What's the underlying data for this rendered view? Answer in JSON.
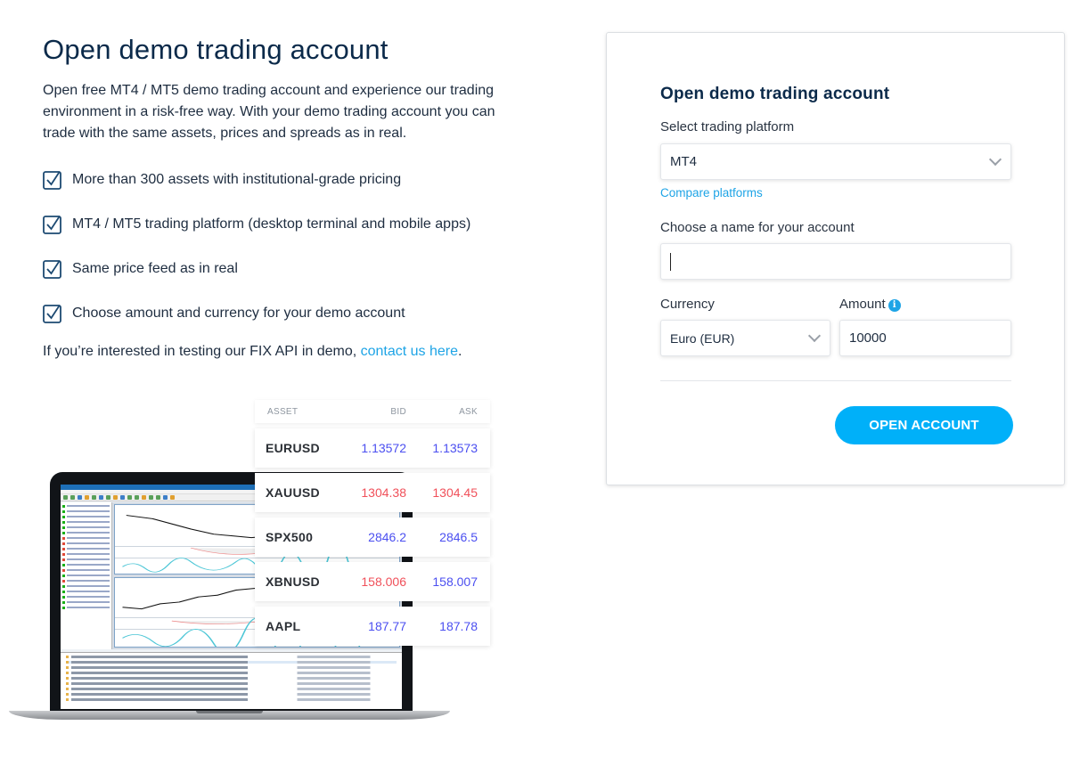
{
  "left": {
    "title": "Open demo trading account",
    "intro": "Open free MT4 / MT5 demo trading account and experience our trading environment in a risk-free way. With your demo trading account you can trade with the same assets, prices and spreads as in real.",
    "features": [
      {
        "icon": "checkbox-checked-icon",
        "text": "More than 300 assets with institutional-grade pricing"
      },
      {
        "icon": "checkbox-checked-icon",
        "text": "MT4 / MT5 trading platform (desktop terminal and mobile apps)"
      },
      {
        "icon": "checkbox-checked-icon",
        "text": "Same price feed as in real"
      },
      {
        "icon": "checkbox-checked-icon",
        "text": "Choose amount and currency for your demo account"
      }
    ],
    "fix_api": {
      "text": "If you’re interested in testing our FIX API in demo, ",
      "link_label": "contact us here",
      "suffix": "."
    }
  },
  "quotes": {
    "headers": {
      "asset": "ASSET",
      "bid": "BID",
      "ask": "ASK"
    },
    "rows": [
      {
        "asset": "EURUSD",
        "bid": "1.13572",
        "ask": "1.13573",
        "bid_dir": "up",
        "ask_dir": "up"
      },
      {
        "asset": "XAUUSD",
        "bid": "1304.38",
        "ask": "1304.45",
        "bid_dir": "down",
        "ask_dir": "down"
      },
      {
        "asset": "SPX500",
        "bid": "2846.2",
        "ask": "2846.5",
        "bid_dir": "up",
        "ask_dir": "up"
      },
      {
        "asset": "XBNUSD",
        "bid": "158.006",
        "ask": "158.007",
        "bid_dir": "down",
        "ask_dir": "up"
      },
      {
        "asset": "AAPL",
        "bid": "187.77",
        "ask": "187.78",
        "bid_dir": "up",
        "ask_dir": "up"
      }
    ],
    "colors": {
      "up": "#4b4ff0",
      "down": "#f0505a"
    }
  },
  "form": {
    "title": "Open demo trading account",
    "platform_label": "Select trading platform",
    "platform_value": "MT4",
    "compare_link": "Compare platforms",
    "name_label": "Choose a name for your account",
    "name_value": "",
    "currency_label": "Currency",
    "currency_value": "Euro (EUR)",
    "amount_label": "Amount",
    "amount_value": "10000",
    "submit_label": "OPEN ACCOUNT"
  },
  "theme": {
    "accent": "#00b0f9",
    "link": "#1ea4e6",
    "heading": "#0b2a4a"
  }
}
